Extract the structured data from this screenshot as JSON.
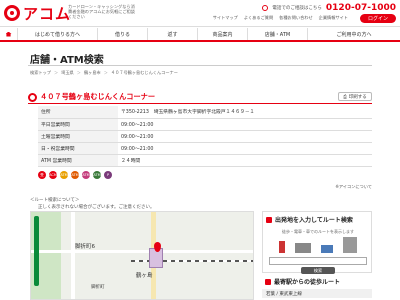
{
  "header": {
    "logo_text": "アコム",
    "tagline": "カードローン・キャッシングなら消費者金融のアコムにお気軽にご相談ください",
    "phone_label": "電話でのご相談はこちら",
    "phone_number": "0120-07-1000",
    "util_links": [
      "サイトマップ",
      "よくあるご質問",
      "各種お問い合わせ",
      "企業情報サイト"
    ],
    "login_label": "ログイン"
  },
  "nav": {
    "items": [
      "はじめて借りる方へ",
      "借りる",
      "返す",
      "商品案内",
      "店舗・ATM",
      "ご利用中の方へ"
    ]
  },
  "page": {
    "title": "店舗・ATM検索",
    "breadcrumb": [
      "検索トップ",
      "埼玉県",
      "鶴ヶ島市",
      "４０７号鶴ヶ島むじんくんコーナー"
    ]
  },
  "store": {
    "name": "４０７号鶴ヶ島むじんくんコーナー",
    "print_label": "印刷する",
    "rows": [
      {
        "key": "住所",
        "value": "〒350-2213　埼玉県鶴ヶ島市大字脚折字北殿戸１４６９－１"
      },
      {
        "key": "平日営業時間",
        "value": "09:00～21:00"
      },
      {
        "key": "土曜営業時間",
        "value": "09:00～21:00"
      },
      {
        "key": "日・祝営業時間",
        "value": "09:00～21:00"
      },
      {
        "key": "ATM 営業時間",
        "value": "２４時間"
      }
    ]
  },
  "services": [
    {
      "label": "受",
      "color": "#e60012"
    },
    {
      "label": "ACM",
      "color": "#e60012"
    },
    {
      "label": "ATM",
      "color": "#e8a000"
    },
    {
      "label": "ATM",
      "color": "#e05a00"
    },
    {
      "label": "ATM",
      "color": "#c43c7c"
    },
    {
      "label": "ATM",
      "color": "#3a7a3a"
    },
    {
      "label": "P",
      "color": "#7a3a7a"
    }
  ],
  "icon_legend": "※アイコンについて",
  "route_note": {
    "title": "＜ルート検索について＞",
    "text": "正しく表示されない場合がございます。ご注意ください。"
  },
  "map": {
    "labels": [
      "鶴ヶ島",
      "脚折町6",
      "脚折町"
    ]
  },
  "route_panel": {
    "title": "出発地を入力してルート検索",
    "caption": "徒歩・電車・車でのルートを表示します",
    "search_label": "検索"
  },
  "station_panel": {
    "title": "最寄駅からの徒歩ルート",
    "line": "若葉 / 東武東上線"
  }
}
